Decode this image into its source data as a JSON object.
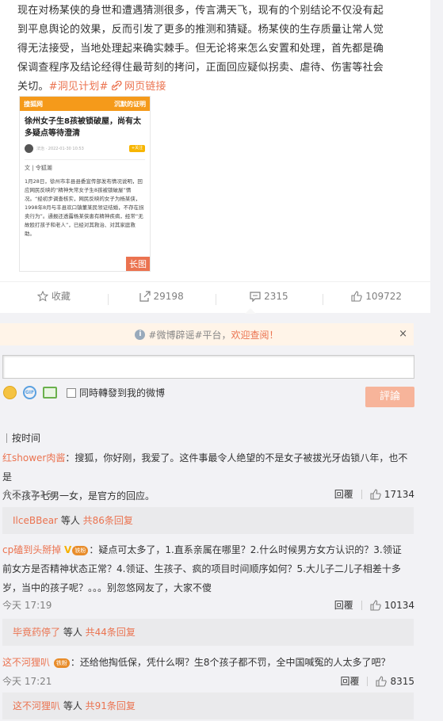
{
  "post": {
    "text_lines": [
      "现在对杨某侠的身世和遭遇猜测很多，传言满天飞，现有的个别结论不仅没有起",
      "到平息舆论的效果，反而引发了更多的推测和猜疑。杨某侠的生存质量让常人觉",
      "得无法接受，当地处理起来确实棘手。但无论将来怎么安置和处理，首先都是确",
      "保调查程序及结论经得住最苛刻的拷问，正面回应疑似拐卖、虐待、伤害等社会"
    ],
    "last_line_prefix": "关切。",
    "hashtag": "#洞见计划#",
    "link_label": "网页链接",
    "image": {
      "source_left": "搜狐网",
      "source_right": "沉默的证明",
      "title": "徐州女子生8孩被锁破屋，尚有太多疑点等待澄清",
      "meta": "法治 · 2022-01-30 10:53",
      "follow": "+关注",
      "author": "文 | 令狐潮",
      "body": "1月28日，徐州市丰县县委宣传部发布情况说明，回应网民反映的“精神失常女子生8孩被锁破屋”情况。“经初步调查核实，网民反映的女子为杨某侠，1998年8月与丰县欢口镇董某民领证结婚，不存在拐卖行为”。通报还透露杨某侠患有精神疾病，经常“无故殴打孩子和老人”，已经对其救治、对其家庭救助。",
      "badge": "长图"
    }
  },
  "actions": {
    "favorite_label": "收藏",
    "repost_count": "29198",
    "comment_count": "2315",
    "like_count": "109722"
  },
  "comment_area": {
    "notice_prefix": "#微博辟谣#平台，",
    "notice_highlight": "欢迎查阅！",
    "notice_close": "×",
    "repost_label": "同時轉發到我的微博",
    "submit_label": "評論",
    "sort_label": "按时间"
  },
  "comments": [
    {
      "user": "红shower肉酱",
      "line1": "：搜狐，你好刚，我爱了。这件事最令人绝望的不是女子被拔光牙齿锁八年，也不是",
      "line2": "八个孩子七男一女，是官方的回应。",
      "time": "今天 17:16",
      "reply_label": "回覆",
      "likes": "17134",
      "replies": {
        "user": "IlceBBear",
        "mid": " 等人 ",
        "more": "共86条回复"
      }
    },
    {
      "user": "cp磕到头掰掉",
      "vbadge": "V",
      "vip": "铁粉",
      "line1": "：疑点可太多了，1.直系亲属在哪里？2.什么时候男方女方认识的？3.领证",
      "line2": "前女方是否精神状态正常？4.领证、生孩子、疯的项目时间顺序如何？5.大儿子二儿子相差十多",
      "line3": "岁，当中的孩子呢？。。。别忽悠网友了，大家不傻",
      "time": "今天 17:19",
      "reply_label": "回覆",
      "likes": "10134",
      "replies": {
        "user": "毕竟药停了",
        "mid": " 等人 ",
        "more": "共44条回复"
      }
    },
    {
      "user": "这不河狸叭",
      "vip": "铁粉",
      "line1": "：还给他掏低保，凭什么啊？生8个孩子都不罚，全中国喊冤的人太多了吧？",
      "time": "今天 17:21",
      "reply_label": "回覆",
      "likes": "8315",
      "replies": {
        "user": "这不河狸叭",
        "mid": " 等人 ",
        "more": "共91条回复"
      }
    }
  ],
  "colors": {
    "accent": "#eb7350",
    "submit": "#f7b49a",
    "notice_bg": "#fff4e8"
  }
}
